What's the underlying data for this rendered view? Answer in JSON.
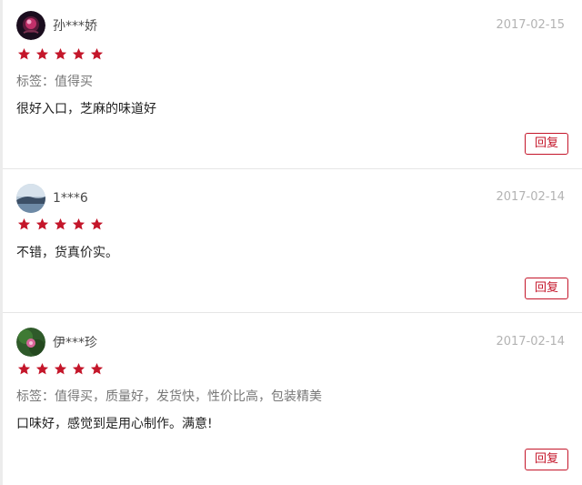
{
  "accent_color": "#c4162a",
  "reviews": [
    {
      "username": "孙***娇",
      "date": "2017-02-15",
      "rating": 5,
      "tag": "标签：值得买",
      "content": "很好入口，芝麻的味道好",
      "reply_label": "回复"
    },
    {
      "username": "1***6",
      "date": "2017-02-14",
      "rating": 5,
      "tag": "",
      "content": "不错，货真价实。",
      "reply_label": "回复"
    },
    {
      "username": "伊***珍",
      "date": "2017-02-14",
      "rating": 5,
      "tag": "标签：值得买，质量好，发货快，性价比高，包装精美",
      "content": "口味好，感觉到是用心制作。满意!",
      "reply_label": "回复"
    }
  ]
}
